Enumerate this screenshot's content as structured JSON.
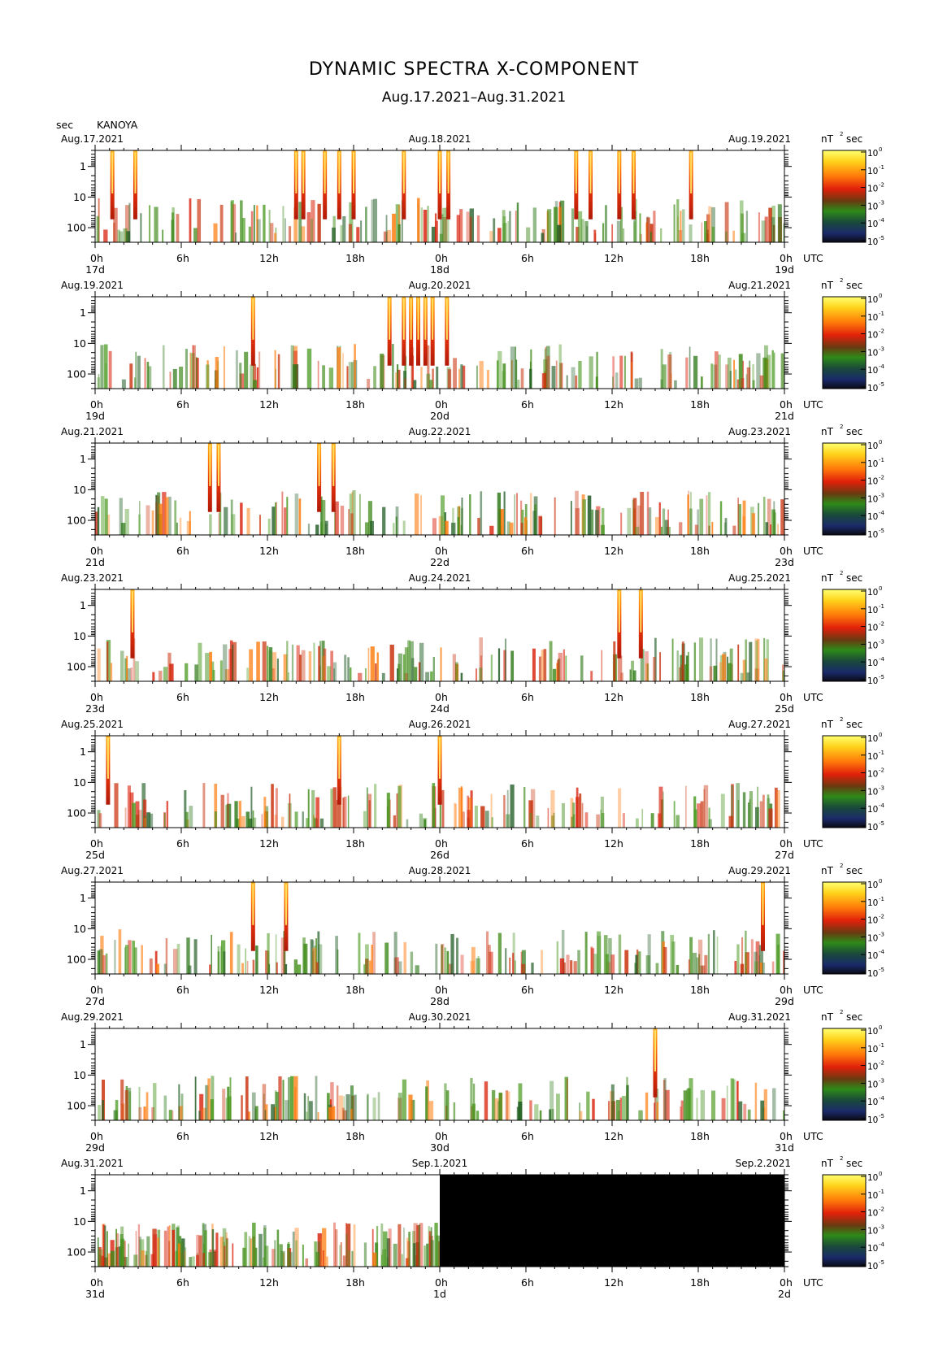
{
  "title": "DYNAMIC SPECTRA X-COMPONENT",
  "subtitle": "Aug.17.2021–Aug.31.2021",
  "station": "KANOYA",
  "y_unit": "sec",
  "colorbar_unit": "nT",
  "colorbar_unit_exp": "2",
  "colorbar_unit_sec": "sec",
  "utc_label": "UTC",
  "y_tick_labels": [
    "1",
    "10",
    "100"
  ],
  "x_hour_labels": [
    "0h",
    "6h",
    "12h",
    "18h",
    "0h",
    "6h",
    "12h",
    "18h",
    "0h"
  ],
  "colorbar_ticks": [
    {
      "base": "10",
      "exp": "0"
    },
    {
      "base": "10",
      "exp": "-1"
    },
    {
      "base": "10",
      "exp": "-2"
    },
    {
      "base": "10",
      "exp": "-3"
    },
    {
      "base": "10",
      "exp": "-4"
    },
    {
      "base": "10",
      "exp": "-5"
    }
  ],
  "colors": {
    "colormap": [
      "#0a0a14",
      "#1a2a6a",
      "#1e5a22",
      "#3f8a18",
      "#d8200a",
      "#ff7a0a",
      "#ffd21a",
      "#ffff80"
    ],
    "no_data": "#000000"
  },
  "chart_data": {
    "type": "heatmap",
    "x_quantity": "time (UTC hours)",
    "y_quantity": "period",
    "y_unit": "sec",
    "y_scale": "log",
    "y_range": [
      0.3,
      300
    ],
    "value_unit": "nT^2 sec",
    "value_scale": "log",
    "value_range": [
      1e-05,
      1
    ],
    "panels": [
      {
        "start_date": "Aug.17.2021",
        "mid_date": "Aug.18.2021",
        "end_date": "Aug.19.2021",
        "day_labels": [
          "17d",
          "18d",
          "19d"
        ],
        "events_hours": [
          1.2,
          2.8,
          14,
          14.5,
          16,
          17,
          18,
          21.5,
          24,
          24.6,
          33.5,
          34.5,
          36.5,
          37.5,
          41.5
        ]
      },
      {
        "start_date": "Aug.19.2021",
        "mid_date": "Aug.20.2021",
        "end_date": "Aug.21.2021",
        "day_labels": [
          "19d",
          "20d",
          "21d"
        ],
        "events_hours": [
          11,
          20.5,
          21.5,
          22,
          22.5,
          23,
          23.5,
          24.5
        ]
      },
      {
        "start_date": "Aug.21.2021",
        "mid_date": "Aug.22.2021",
        "end_date": "Aug.23.2021",
        "day_labels": [
          "21d",
          "22d",
          "23d"
        ],
        "events_hours": [
          8,
          8.6,
          15.6,
          16.6
        ]
      },
      {
        "start_date": "Aug.23.2021",
        "mid_date": "Aug.24.2021",
        "end_date": "Aug.25.2021",
        "day_labels": [
          "23d",
          "24d",
          "25d"
        ],
        "events_hours": [
          2.6,
          36.5,
          38
        ]
      },
      {
        "start_date": "Aug.25.2021",
        "mid_date": "Aug.26.2021",
        "end_date": "Aug.27.2021",
        "day_labels": [
          "25d",
          "26d",
          "27d"
        ],
        "events_hours": [
          0.9,
          17,
          24
        ]
      },
      {
        "start_date": "Aug.27.2021",
        "mid_date": "Aug.28.2021",
        "end_date": "Aug.29.2021",
        "day_labels": [
          "27d",
          "28d",
          "29d"
        ],
        "events_hours": [
          11,
          13.3,
          46.5
        ]
      },
      {
        "start_date": "Aug.29.2021",
        "mid_date": "Aug.30.2021",
        "end_date": "Aug.31.2021",
        "day_labels": [
          "29d",
          "30d",
          "31d"
        ],
        "events_hours": [
          39
        ]
      },
      {
        "start_date": "Aug.31.2021",
        "mid_date": "Sep.1.2021",
        "end_date": "Sep.2.2021",
        "day_labels": [
          "31d",
          "1d",
          "2d"
        ],
        "events_hours": [],
        "data_until_hour": 24
      }
    ]
  }
}
